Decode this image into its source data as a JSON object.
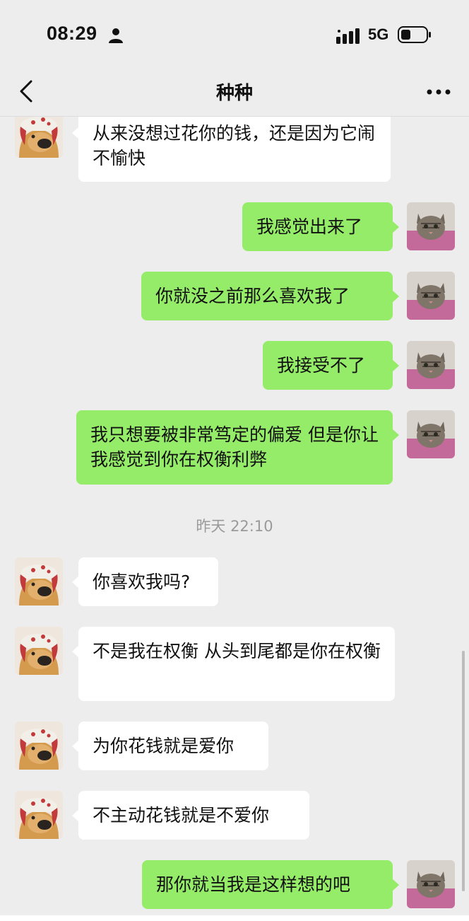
{
  "status_bar": {
    "time": "08:29",
    "network": "5G"
  },
  "nav": {
    "title": "种种"
  },
  "chat": {
    "messages": [
      {
        "side": "left",
        "text": "从来没想过花你的钱，还是因为它闹不愉快"
      },
      {
        "side": "right",
        "text": "我感觉出来了"
      },
      {
        "side": "right",
        "text": "你就没之前那么喜欢我了"
      },
      {
        "side": "right",
        "text": "我接受不了"
      },
      {
        "side": "right",
        "text": "我只想要被非常笃定的偏爱 但是你让我感觉到你在权衡利弊"
      },
      {
        "side": "left",
        "text": "你喜欢我吗?"
      },
      {
        "side": "left",
        "text": "不是我在权衡 从头到尾都是你在权衡"
      },
      {
        "side": "left",
        "text": "为你花钱就是爱你"
      },
      {
        "side": "left",
        "text": "不主动花钱就是不爱你"
      },
      {
        "side": "right",
        "text": "那你就当我是这样想的吧"
      }
    ],
    "timestamp": "昨天 22:10"
  },
  "icons": {
    "back": "chevron-left-icon",
    "more": "more-dots-icon",
    "person": "person-icon",
    "signal": "signal-icon",
    "battery": "battery-icon"
  },
  "colors": {
    "background": "#ededed",
    "outgoing_bubble": "#95ec69",
    "incoming_bubble": "#ffffff",
    "timestamp_text": "#9a9a9a"
  }
}
